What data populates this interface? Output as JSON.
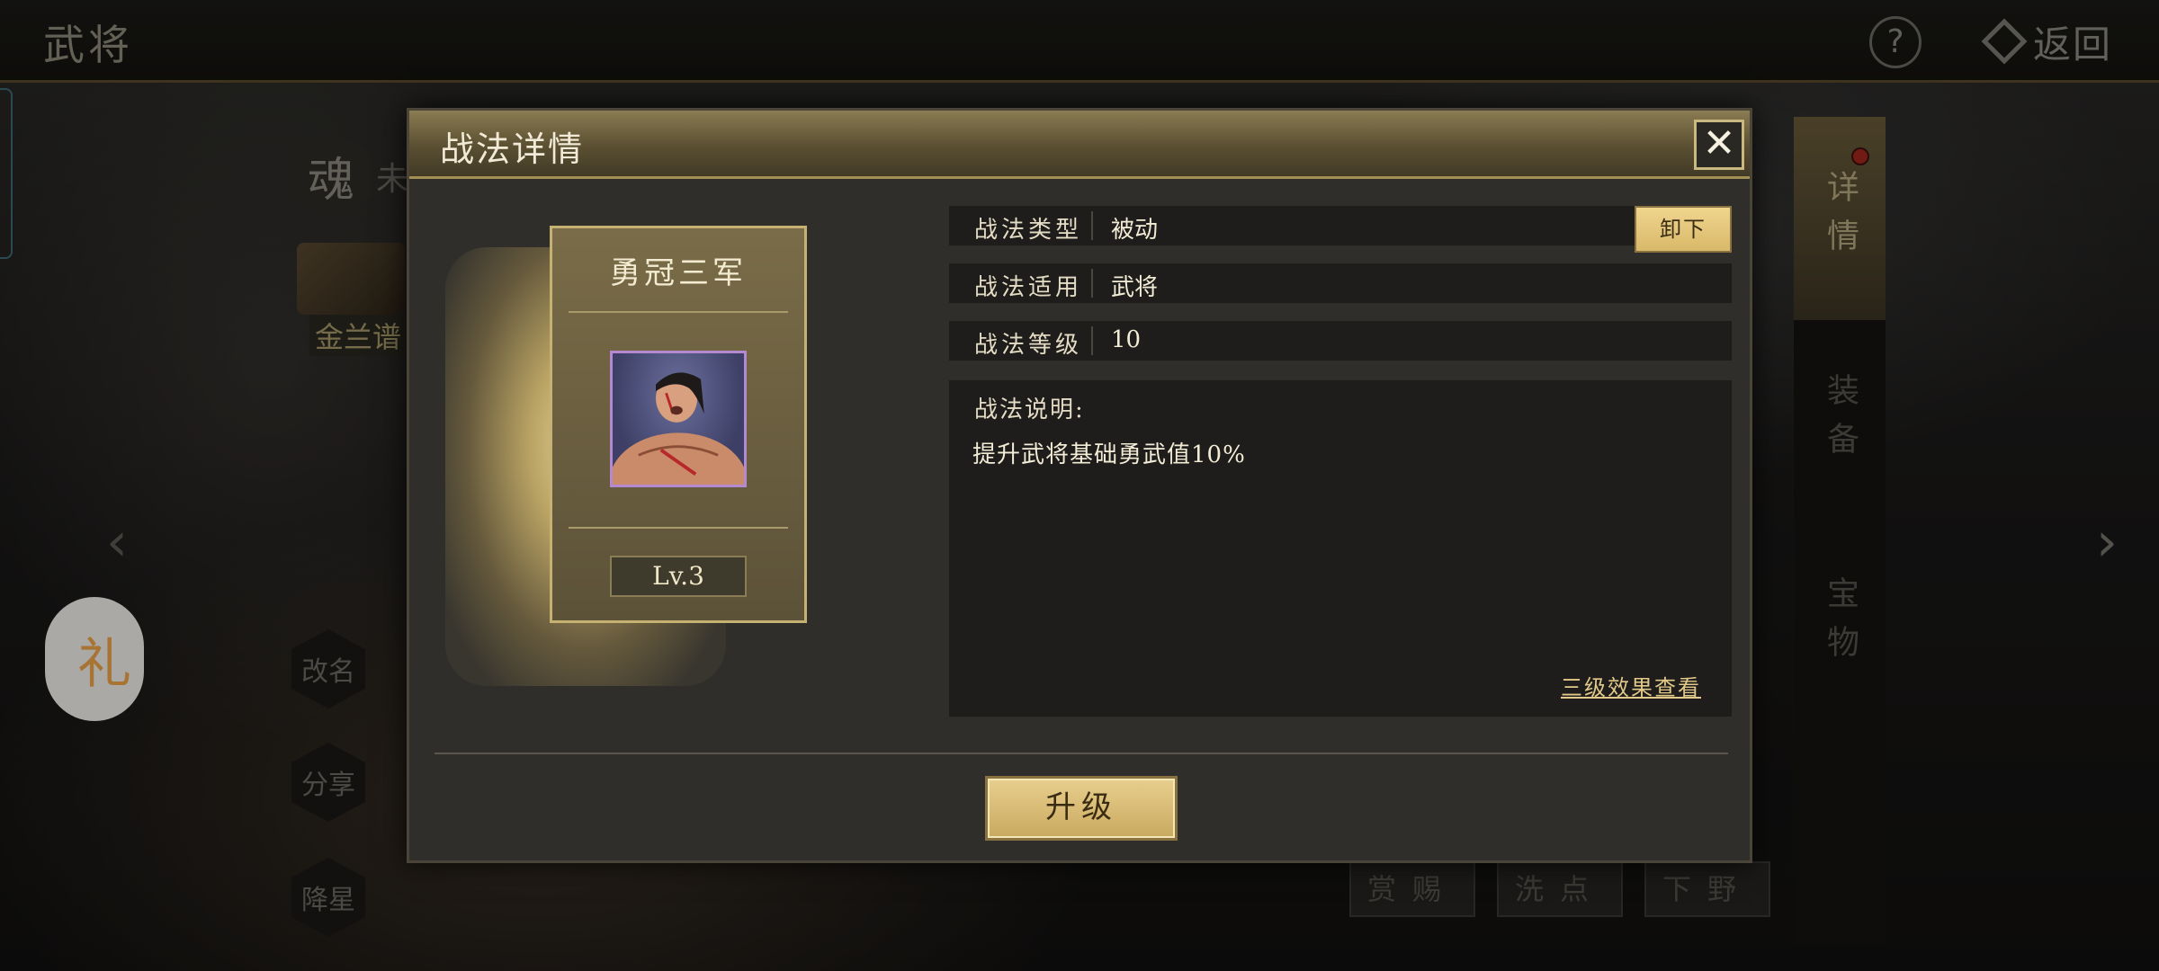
{
  "screen": {
    "title": "武将",
    "help_label": "?",
    "back_label": "返回"
  },
  "background": {
    "soul_char": "魂",
    "soul_tail": "未",
    "book_label": "金兰谱",
    "left_actions": [
      "改名",
      "分享",
      "降星"
    ],
    "side_tabs": [
      "详情",
      "装备",
      "宝物"
    ],
    "bottom_actions": [
      "赏赐",
      "洗点",
      "下野"
    ],
    "float_char": "礼",
    "arrow_left": "‹",
    "arrow_right": "›"
  },
  "modal": {
    "title": "战法详情",
    "close_label": "✕",
    "skill": {
      "name": "勇冠三军",
      "level": "Lv.3",
      "portrait_icon": "warrior-portrait-icon"
    },
    "info": [
      {
        "key": "战法类型",
        "value": "被动"
      },
      {
        "key": "战法适用",
        "value": "武将"
      },
      {
        "key": "战法等级",
        "value": "10"
      }
    ],
    "unequip_label": "卸下",
    "description": {
      "title": "战法说明:",
      "text": "提升武将基础勇武值10%",
      "link": "三级效果查看"
    },
    "upgrade_label": "升级"
  },
  "colors": {
    "accent_gold": "#c9b87f",
    "button_gold": "#e0c57d",
    "notification_red": "#a4281d"
  }
}
